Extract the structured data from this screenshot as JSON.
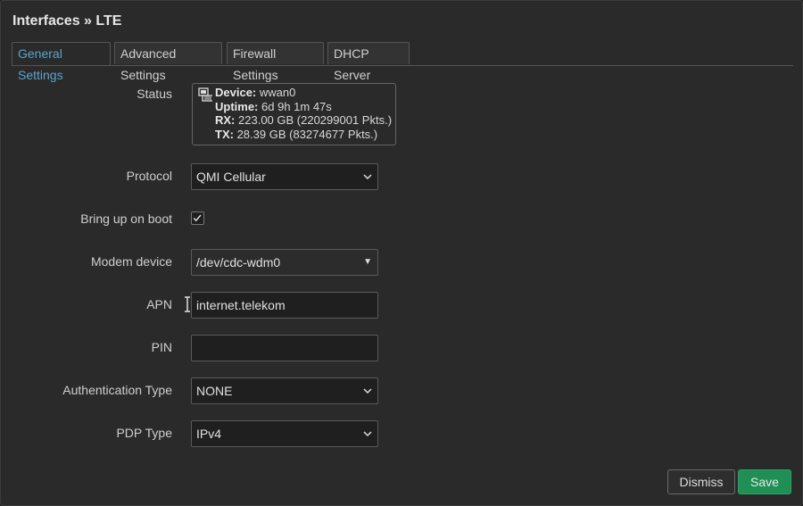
{
  "title": "Interfaces » LTE",
  "tabs": [
    {
      "label": "General Settings",
      "active": true
    },
    {
      "label": "Advanced Settings",
      "active": false
    },
    {
      "label": "Firewall Settings",
      "active": false
    },
    {
      "label": "DHCP Server",
      "active": false
    }
  ],
  "status": {
    "label": "Status",
    "icon": "network-interface-icon",
    "device_key": "Device:",
    "device_val": "wwan0",
    "uptime_key": "Uptime:",
    "uptime_val": "6d 9h 1m 47s",
    "rx_key": "RX:",
    "rx_val": "223.00 GB (220299001 Pkts.)",
    "tx_key": "TX:",
    "tx_val": "28.39 GB (83274677 Pkts.)"
  },
  "protocol": {
    "label": "Protocol",
    "value": "QMI Cellular"
  },
  "boot": {
    "label": "Bring up on boot",
    "checked": true
  },
  "modem": {
    "label": "Modem device",
    "value": "/dev/cdc-wdm0"
  },
  "apn": {
    "label": "APN",
    "value": "internet.telekom"
  },
  "pin": {
    "label": "PIN",
    "value": ""
  },
  "auth": {
    "label": "Authentication Type",
    "value": "NONE"
  },
  "pdp": {
    "label": "PDP Type",
    "value": "IPv4"
  },
  "buttons": {
    "dismiss": "Dismiss",
    "save": "Save"
  },
  "colors": {
    "accent": "#5aa4cf",
    "save": "#1f8f55",
    "background": "#2a2a2a"
  }
}
